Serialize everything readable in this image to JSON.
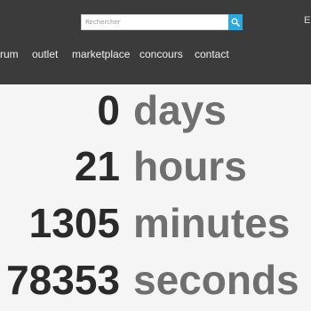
{
  "search": {
    "placeholder": "Rechercher"
  },
  "header": {
    "corner_letter": "E"
  },
  "nav": {
    "items": [
      {
        "label": "rum"
      },
      {
        "label": "outlet"
      },
      {
        "label": "marketplace"
      },
      {
        "label": "concours"
      },
      {
        "label": "contact"
      }
    ]
  },
  "countdown": {
    "rows": [
      {
        "value": "0",
        "unit": "days"
      },
      {
        "value": "21",
        "unit": "hours"
      },
      {
        "value": "1305",
        "unit": "minutes"
      },
      {
        "value": "78353",
        "unit": "seconds"
      }
    ]
  },
  "colors": {
    "topbar_bg": "#3b3b3b",
    "search_button": "#29a9e1",
    "number_text": "#2a2a2a",
    "unit_text": "#6f6f6f",
    "page_bg": "#f5f5f5"
  },
  "icons": {
    "search": "search-icon"
  }
}
